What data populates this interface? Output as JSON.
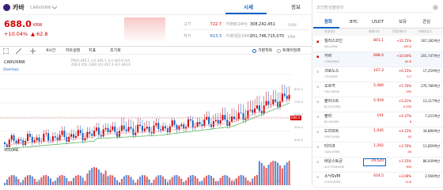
{
  "header": {
    "coin_name": "카바",
    "pair": "CARV/KRW",
    "tab_price": "시세",
    "tab_info": "정보",
    "price": "688.0",
    "currency": "KRW",
    "change_pct": "+10.04%",
    "change_amt": "▲ 62.8"
  },
  "stats": {
    "high_label": "고가",
    "high_value": "722.7",
    "low_label": "저가",
    "low_value": "613.3",
    "vol_label": "거래량(24H)",
    "vol_value": "308,242,451",
    "vol_unit": "CARV",
    "amt_label": "거래대금(24H)",
    "amt_value": "201,746,715,070",
    "amt_unit": "KRW"
  },
  "toolbar": {
    "interval": "4시간",
    "indicators": "차트설정",
    "settings": "지표",
    "reset": "초기화",
    "basic_chart": "기본차트",
    "tradingview": "트레이딩뷰"
  },
  "chart": {
    "pair": "CARV/KRW",
    "ohlc": "PREV 445.1 시가 445.1 고가 445.6 저가 446.0 VOL 1444 상가 447.3 저가 444.6",
    "overlays": "Overlays",
    "volume": "VOLUME",
    "price_tag": "688.0",
    "y_labels": [
      "800.0",
      "700.0",
      "600.0",
      "500.0",
      "400.0"
    ],
    "x_labels": [
      "16",
      "17",
      "18",
      "19",
      "20",
      "21",
      "22",
      "23",
      "24",
      "25",
      "26",
      "27",
      "28"
    ]
  },
  "chart_data": {
    "type": "candlestick",
    "title": "CARV/KRW",
    "x_ticks": [
      "16",
      "17",
      "18",
      "19",
      "20",
      "21",
      "22",
      "23",
      "24",
      "25",
      "26",
      "27",
      "28"
    ],
    "y_ticks": [
      800,
      700,
      600,
      500,
      400
    ],
    "last_price": 688.0
  },
  "side": {
    "search_placeholder": "코인명/심볼검색",
    "tabs": [
      "원화",
      "BTC",
      "USDT",
      "보유",
      "관심"
    ],
    "col_name": "한글명↕",
    "col_price": "현재가↕",
    "col_change": "전일대비↕",
    "col_volume": "거래대금↕",
    "rows": [
      {
        "name": "월러스코인",
        "sym": "WAL/KRW",
        "price": "801.1",
        "chg": "+15.75%",
        "chg2": "109.0",
        "vol": "167,182백만",
        "up": true
      },
      {
        "name": "카바",
        "sym": "CARV/KRW",
        "price": "688.0",
        "chg": "+10.04%",
        "chg2": "62.8",
        "vol": "201,747백만",
        "up": true
      },
      {
        "name": "크로노스",
        "sym": "CRO/KRW",
        "price": "167.3",
        "chg": "+6.15%",
        "chg2": "9.7",
        "vol": "17,259백만",
        "up": true
      },
      {
        "name": "오르카",
        "sym": "ORCA/KRW",
        "price": "5,480",
        "chg": "+5.70%",
        "chg2": "295",
        "vol": "276,786백만",
        "up": true
      },
      {
        "name": "블라스트",
        "sym": "BLAST/KRW",
        "price": "5.959",
        "chg": "+5.21%",
        "chg2": "0.295",
        "vol": "13,117백만",
        "up": true
      },
      {
        "name": "블러",
        "sym": "BLUR/KRW",
        "price": "191",
        "chg": "+4.37%",
        "chg2": "8",
        "vol": "7,221백만",
        "up": true
      },
      {
        "name": "드리프트",
        "sym": "DRIFT/KRW",
        "price": "1,045",
        "chg": "+4.15%",
        "chg2": "40",
        "vol": "34,896백만",
        "up": true
      },
      {
        "name": "타이코",
        "sym": "TAIKO/KRW",
        "price": "1,292",
        "chg": "+3.70%",
        "chg2": "46",
        "vol": "11,859백만",
        "up": true
      },
      {
        "name": "바운스토큰",
        "sym": "AUCTION/KRW",
        "price": "29,520",
        "chg": "+3.15%",
        "chg2": "900",
        "vol": "86,939백만",
        "up": true
      },
      {
        "name": "소닉SVM",
        "sym": "SONIC/KRW",
        "price": "424.5",
        "chg": "+3.06%",
        "chg2": "12.6",
        "vol": "2,566백만",
        "up": true
      }
    ]
  }
}
